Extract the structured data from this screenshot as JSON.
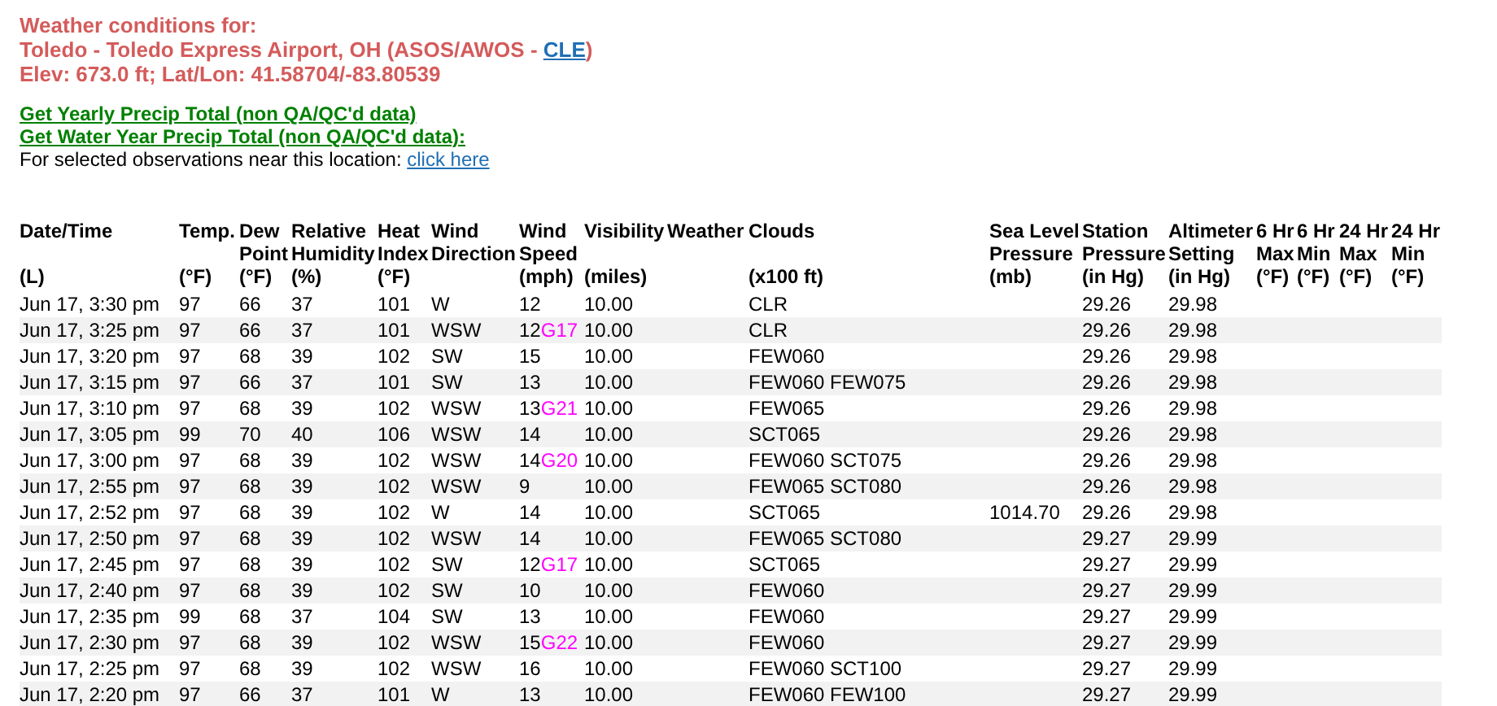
{
  "header": {
    "title": "Weather conditions for:",
    "station_prefix": "Toledo - Toledo Express Airport, OH (ASOS/AWOS - ",
    "station_link": "CLE",
    "station_suffix": ")",
    "elevation": "Elev: 673.0 ft; Lat/Lon: 41.58704/-83.80539"
  },
  "links": [
    {
      "text": "Get Yearly Precip Total (non QA/QC'd data)"
    },
    {
      "text": "Get Water Year Precip Total (non QA/QC'd data):"
    }
  ],
  "nearby": {
    "text": "For selected observations near this location: ",
    "link": "click here"
  },
  "table": {
    "columns": [
      {
        "lines": [
          "Date/Time"
        ],
        "unit": "(L)"
      },
      {
        "lines": [
          "Temp."
        ],
        "unit": "(°F)"
      },
      {
        "lines": [
          "Dew",
          "Point"
        ],
        "unit": "(°F)"
      },
      {
        "lines": [
          "Relative",
          "Humidity"
        ],
        "unit": "(%)"
      },
      {
        "lines": [
          "Heat",
          "Index"
        ],
        "unit": "(°F)"
      },
      {
        "lines": [
          "Wind",
          "Direction"
        ]
      },
      {
        "lines": [
          "Wind",
          "Speed"
        ],
        "unit": "(mph)"
      },
      {
        "lines": [
          "Visibility"
        ],
        "unit": "(miles)"
      },
      {
        "lines": [
          "Weather"
        ]
      },
      {
        "lines": [
          "Clouds"
        ],
        "unit": "(x100 ft)"
      },
      {
        "lines": [
          "Sea Level",
          "Pressure"
        ],
        "unit": "(mb)"
      },
      {
        "lines": [
          "Station",
          "Pressure"
        ],
        "unit": "(in Hg)"
      },
      {
        "lines": [
          "Altimeter",
          "Setting"
        ],
        "unit": "(in Hg)"
      },
      {
        "lines": [
          "6 Hr",
          "Max"
        ],
        "unit": "(°F)"
      },
      {
        "lines": [
          "6 Hr",
          "Min"
        ],
        "unit": "(°F)"
      },
      {
        "lines": [
          "24 Hr",
          "Max"
        ],
        "unit": "(°F)"
      },
      {
        "lines": [
          "24 Hr",
          "Min"
        ],
        "unit": "(°F)"
      }
    ],
    "rows": [
      {
        "time": "Jun 17, 3:30 pm",
        "temp": "97",
        "dew": "66",
        "rh": "37",
        "heat": "101",
        "dir": "W",
        "speed": "12",
        "vis": "10.00",
        "clouds": "CLR",
        "station": "29.26",
        "alt": "29.98"
      },
      {
        "time": "Jun 17, 3:25 pm",
        "temp": "97",
        "dew": "66",
        "rh": "37",
        "heat": "101",
        "dir": "WSW",
        "speed": "12",
        "gust": "G17",
        "vis": "10.00",
        "clouds": "CLR",
        "station": "29.26",
        "alt": "29.98"
      },
      {
        "time": "Jun 17, 3:20 pm",
        "temp": "97",
        "dew": "68",
        "rh": "39",
        "heat": "102",
        "dir": "SW",
        "speed": "15",
        "vis": "10.00",
        "clouds": "FEW060",
        "station": "29.26",
        "alt": "29.98"
      },
      {
        "time": "Jun 17, 3:15 pm",
        "temp": "97",
        "dew": "66",
        "rh": "37",
        "heat": "101",
        "dir": "SW",
        "speed": "13",
        "vis": "10.00",
        "clouds": "FEW060 FEW075",
        "station": "29.26",
        "alt": "29.98"
      },
      {
        "time": "Jun 17, 3:10 pm",
        "temp": "97",
        "dew": "68",
        "rh": "39",
        "heat": "102",
        "dir": "WSW",
        "speed": "13",
        "gust": "G21",
        "vis": "10.00",
        "clouds": "FEW065",
        "station": "29.26",
        "alt": "29.98"
      },
      {
        "time": "Jun 17, 3:05 pm",
        "temp": "99",
        "dew": "70",
        "rh": "40",
        "heat": "106",
        "dir": "WSW",
        "speed": "14",
        "vis": "10.00",
        "clouds": "SCT065",
        "station": "29.26",
        "alt": "29.98"
      },
      {
        "time": "Jun 17, 3:00 pm",
        "temp": "97",
        "dew": "68",
        "rh": "39",
        "heat": "102",
        "dir": "WSW",
        "speed": "14",
        "gust": "G20",
        "vis": "10.00",
        "clouds": "FEW060 SCT075",
        "station": "29.26",
        "alt": "29.98"
      },
      {
        "time": "Jun 17, 2:55 pm",
        "temp": "97",
        "dew": "68",
        "rh": "39",
        "heat": "102",
        "dir": "WSW",
        "speed": "9",
        "vis": "10.00",
        "clouds": "FEW065 SCT080",
        "station": "29.26",
        "alt": "29.98"
      },
      {
        "time": "Jun 17, 2:52 pm",
        "temp": "97",
        "dew": "68",
        "rh": "39",
        "heat": "102",
        "dir": "W",
        "speed": "14",
        "vis": "10.00",
        "clouds": "SCT065",
        "slp": "1014.70",
        "station": "29.26",
        "alt": "29.98"
      },
      {
        "time": "Jun 17, 2:50 pm",
        "temp": "97",
        "dew": "68",
        "rh": "39",
        "heat": "102",
        "dir": "WSW",
        "speed": "14",
        "vis": "10.00",
        "clouds": "FEW065 SCT080",
        "station": "29.27",
        "alt": "29.99"
      },
      {
        "time": "Jun 17, 2:45 pm",
        "temp": "97",
        "dew": "68",
        "rh": "39",
        "heat": "102",
        "dir": "SW",
        "speed": "12",
        "gust": "G17",
        "vis": "10.00",
        "clouds": "SCT065",
        "station": "29.27",
        "alt": "29.99"
      },
      {
        "time": "Jun 17, 2:40 pm",
        "temp": "97",
        "dew": "68",
        "rh": "39",
        "heat": "102",
        "dir": "SW",
        "speed": "10",
        "vis": "10.00",
        "clouds": "FEW060",
        "station": "29.27",
        "alt": "29.99"
      },
      {
        "time": "Jun 17, 2:35 pm",
        "temp": "99",
        "dew": "68",
        "rh": "37",
        "heat": "104",
        "dir": "SW",
        "speed": "13",
        "vis": "10.00",
        "clouds": "FEW060",
        "station": "29.27",
        "alt": "29.99"
      },
      {
        "time": "Jun 17, 2:30 pm",
        "temp": "97",
        "dew": "68",
        "rh": "39",
        "heat": "102",
        "dir": "WSW",
        "speed": "15",
        "gust": "G22",
        "vis": "10.00",
        "clouds": "FEW060",
        "station": "29.27",
        "alt": "29.99"
      },
      {
        "time": "Jun 17, 2:25 pm",
        "temp": "97",
        "dew": "68",
        "rh": "39",
        "heat": "102",
        "dir": "WSW",
        "speed": "16",
        "vis": "10.00",
        "clouds": "FEW060 SCT100",
        "station": "29.27",
        "alt": "29.99"
      },
      {
        "time": "Jun 17, 2:20 pm",
        "temp": "97",
        "dew": "66",
        "rh": "37",
        "heat": "101",
        "dir": "W",
        "speed": "13",
        "vis": "10.00",
        "clouds": "FEW060 FEW100",
        "station": "29.27",
        "alt": "29.99"
      }
    ]
  }
}
